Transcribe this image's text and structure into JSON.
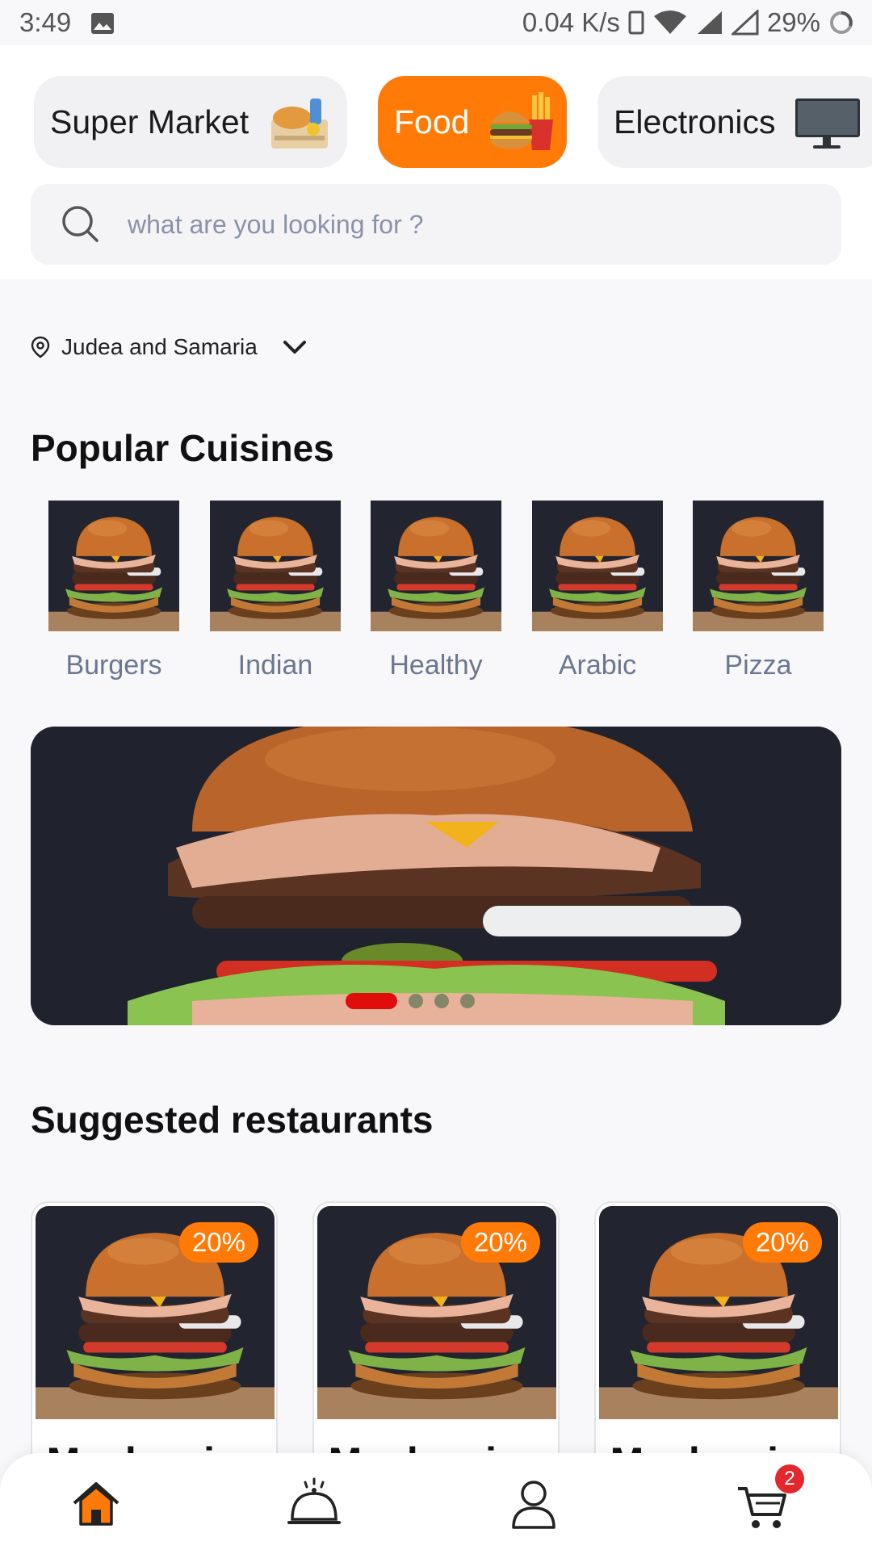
{
  "status_bar": {
    "time": "3:49",
    "network_speed": "0.04 K/s",
    "battery": "29%"
  },
  "categories": [
    {
      "label": "Super Market",
      "icon": "grocery-bag-icon"
    },
    {
      "label": "Food",
      "icon": "burger-fries-icon",
      "active": true
    },
    {
      "label": "Electronics",
      "icon": "tv-icon"
    }
  ],
  "search": {
    "placeholder": "what are you looking for ?"
  },
  "location": {
    "label": "Judea and Samaria"
  },
  "popular": {
    "title": "Popular Cuisines",
    "items": [
      {
        "label": "Burgers"
      },
      {
        "label": "Indian"
      },
      {
        "label": "Healthy"
      },
      {
        "label": "Arabic"
      },
      {
        "label": "Pizza"
      }
    ]
  },
  "banner": {
    "active_slide": 1,
    "slide_count": 4
  },
  "suggested": {
    "title": "Suggested restaurants",
    "items": [
      {
        "name": "Machawina",
        "discount": "20%"
      },
      {
        "name": "Machawina",
        "discount": "20%"
      },
      {
        "name": "Machawina",
        "discount": "20%"
      }
    ]
  },
  "bottom_nav": {
    "items": [
      "home-icon",
      "dish-icon",
      "profile-icon",
      "cart-icon"
    ],
    "cart_count": "2"
  },
  "colors": {
    "accent": "#ff7a07",
    "badge_red": "#e4272d",
    "muted_label": "#6b7690"
  }
}
